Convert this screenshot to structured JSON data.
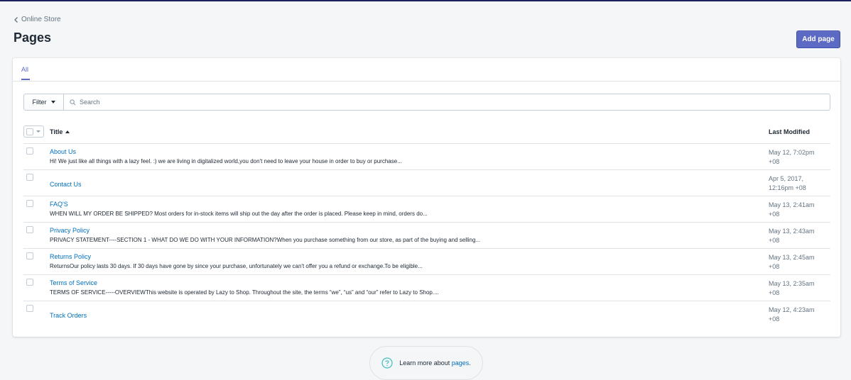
{
  "breadcrumb": {
    "label": "Online Store"
  },
  "page": {
    "title": "Pages",
    "add_label": "Add page"
  },
  "tabs": [
    {
      "label": "All"
    }
  ],
  "filter": {
    "button_label": "Filter",
    "search_placeholder": "Search"
  },
  "table": {
    "col_title": "Title",
    "col_modified": "Last Modified",
    "rows": [
      {
        "title": "About Us",
        "excerpt": "Hi! We just like all things with a lazy feel. :) we are living in  digitalized world,you don't need to leave your house in order to buy or purchase...",
        "modified_1": "May 12, 7:02pm",
        "modified_2": "+08"
      },
      {
        "title": "Contact Us",
        "excerpt": "",
        "modified_1": "Apr 5, 2017,",
        "modified_2": "12:16pm +08"
      },
      {
        "title": "FAQ'S",
        "excerpt": "WHEN WILL MY ORDER BE SHIPPED? Most orders for in-stock items will ship out the day after the order is placed.  Please keep in mind, orders do...",
        "modified_1": "May 13, 2:41am",
        "modified_2": "+08"
      },
      {
        "title": "Privacy Policy",
        "excerpt": "PRIVACY STATEMENT----SECTION 1 - WHAT DO WE DO WITH YOUR INFORMATION?When you purchase something from our store, as part of the buying and selling...",
        "modified_1": "May 13, 2:43am",
        "modified_2": "+08"
      },
      {
        "title": "Returns Policy",
        "excerpt": "ReturnsOur policy lasts 30 days. If 30 days have gone by since your purchase, unfortunately we can't offer you a refund or exchange.To be eligible...",
        "modified_1": "May 13, 2:45am",
        "modified_2": "+08"
      },
      {
        "title": "Terms of Service",
        "excerpt": "TERMS OF SERVICE-----OVERVIEWThis website is operated by Lazy to Shop. Throughout the site, the terms “we”, “us” and “our” refer to Lazy to Shop....",
        "modified_1": "May 13, 2:35am",
        "modified_2": "+08"
      },
      {
        "title": "Track Orders",
        "excerpt": "",
        "modified_1": "May 12, 4:23am",
        "modified_2": "+08"
      }
    ]
  },
  "help": {
    "prefix": "Learn more about ",
    "link": "pages",
    "suffix": "."
  },
  "icons": {
    "back": "chevron-left-icon",
    "search": "search-icon",
    "help": "question-circle-icon"
  },
  "colors": {
    "primary": "#5c6ac4",
    "link": "#006fbb",
    "top_bar": "#1c2260"
  }
}
